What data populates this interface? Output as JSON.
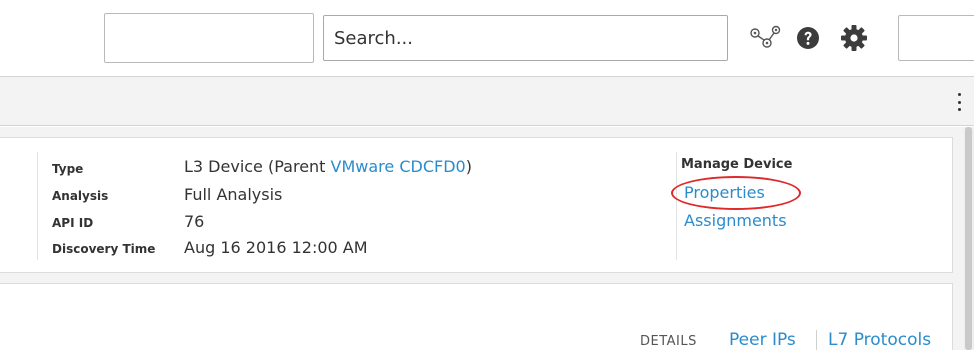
{
  "search": {
    "placeholder": "Search..."
  },
  "icons": {
    "network": "network-icon",
    "help": "question-circle-icon",
    "settings": "gear-icon",
    "more": "kebab-menu-icon"
  },
  "device": {
    "fields": [
      {
        "label": "Type",
        "value_prefix": "L3 Device (Parent ",
        "parent_link": "VMware CDCFD0",
        "value_suffix": ")"
      },
      {
        "label": "Analysis",
        "value": "Full Analysis"
      },
      {
        "label": "API ID",
        "value": "76"
      },
      {
        "label": "Discovery Time",
        "value": "Aug 16 2016 12:00 AM"
      }
    ]
  },
  "manage": {
    "title": "Manage Device",
    "properties": "Properties",
    "assignments": "Assignments"
  },
  "panel": {
    "details_label": "DETAILS",
    "links": [
      "Peer IPs",
      "L7 Protocols"
    ]
  },
  "colors": {
    "link": "#2a8ccd",
    "highlight": "#e0292a",
    "toolbar_bg": "#f3f3f3"
  }
}
